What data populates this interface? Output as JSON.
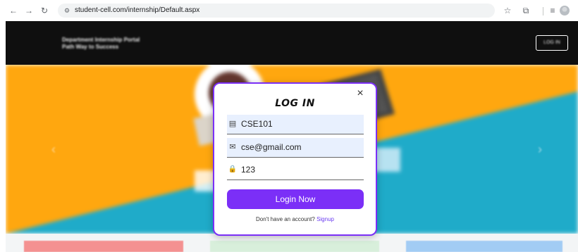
{
  "browser": {
    "url": "student-cell.com/internship/Default.aspx",
    "icons": {
      "back": "←",
      "forward": "→",
      "reload": "↻",
      "site_info": "⚙",
      "bookmark": "☆",
      "extensions": "⧉",
      "tab_search": "≡"
    }
  },
  "header": {
    "brand_line1": "Department Internship Portal",
    "brand_line2": "Path Way to Success",
    "login_label": "LOG IN"
  },
  "hero": {
    "prev_arrow": "‹",
    "next_arrow": "›",
    "colors": {
      "orange": "#ffa200",
      "teal": "#12a6c6"
    }
  },
  "login_modal": {
    "close": "×",
    "title": "LOG IN",
    "username": {
      "icon": "▤",
      "value": "CSE101"
    },
    "email": {
      "icon": "✉",
      "value": "cse@gmail.com"
    },
    "password": {
      "icon": "🔒",
      "value": "123"
    },
    "submit_label": "Login Now",
    "signup_prompt": "Don't have an account?",
    "signup_link": "Signup"
  },
  "colors": {
    "accent": "#7b2ff7",
    "field_bg": "#e8f0fe",
    "header_bg": "#000000"
  }
}
